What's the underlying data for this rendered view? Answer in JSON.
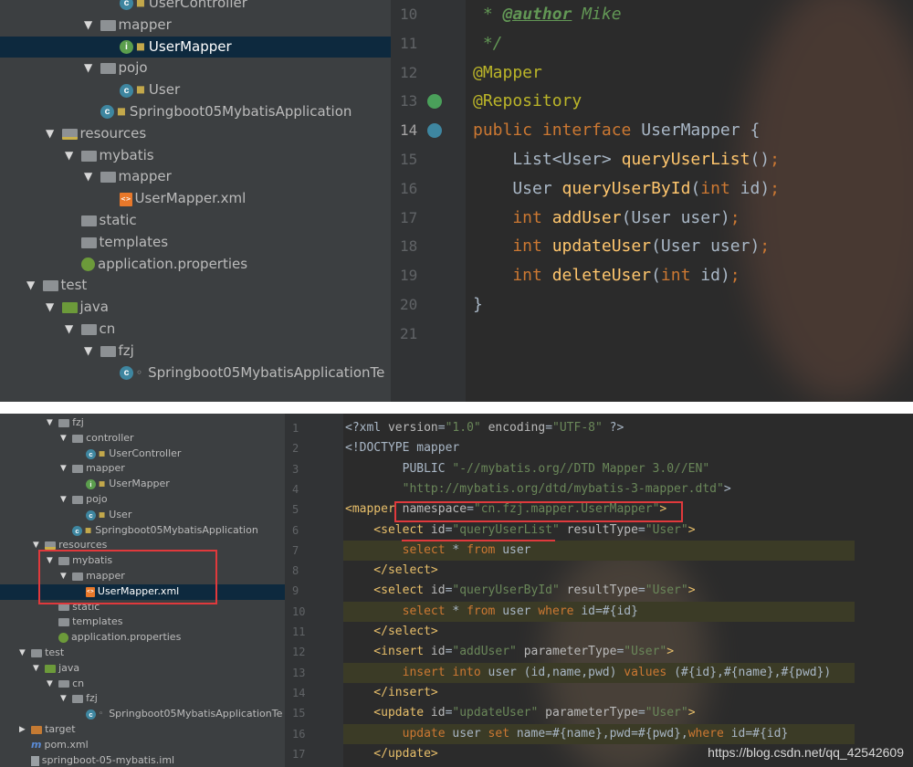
{
  "top_panel": {
    "tree": [
      {
        "indent": 5,
        "arrow": "",
        "icon": "class",
        "label": "UserController"
      },
      {
        "indent": 4,
        "arrow": "▼",
        "icon": "folder",
        "label": "mapper"
      },
      {
        "indent": 5,
        "arrow": "",
        "icon": "interface",
        "label": "UserMapper",
        "selected": true
      },
      {
        "indent": 4,
        "arrow": "▼",
        "icon": "folder",
        "label": "pojo"
      },
      {
        "indent": 5,
        "arrow": "",
        "icon": "class",
        "label": "User"
      },
      {
        "indent": 4,
        "arrow": "",
        "icon": "springclass",
        "label": "Springboot05MybatisApplication"
      },
      {
        "indent": 2,
        "arrow": "▼",
        "icon": "resfolder",
        "label": "resources"
      },
      {
        "indent": 3,
        "arrow": "▼",
        "icon": "folder",
        "label": "mybatis"
      },
      {
        "indent": 4,
        "arrow": "▼",
        "icon": "folder",
        "label": "mapper"
      },
      {
        "indent": 5,
        "arrow": "",
        "icon": "xml",
        "label": "UserMapper.xml"
      },
      {
        "indent": 3,
        "arrow": "",
        "icon": "folder",
        "label": "static"
      },
      {
        "indent": 3,
        "arrow": "",
        "icon": "folder",
        "label": "templates"
      },
      {
        "indent": 3,
        "arrow": "",
        "icon": "properties",
        "label": "application.properties"
      },
      {
        "indent": 1,
        "arrow": "▼",
        "icon": "folder",
        "label": "test"
      },
      {
        "indent": 2,
        "arrow": "▼",
        "icon": "greenfolder",
        "label": "java"
      },
      {
        "indent": 3,
        "arrow": "▼",
        "icon": "folder",
        "label": "cn"
      },
      {
        "indent": 4,
        "arrow": "▼",
        "icon": "folder",
        "label": "fzj"
      },
      {
        "indent": 5,
        "arrow": "",
        "icon": "testclass",
        "label": "Springboot05MybatisApplicationTe"
      }
    ],
    "line_numbers": [
      "10",
      "11",
      "12",
      "13",
      "14",
      "15",
      "16",
      "17",
      "18",
      "19",
      "20",
      "21"
    ],
    "code": [
      [
        {
          "c": "dk",
          "t": " * "
        },
        {
          "c": "dtag",
          "t": "@author"
        },
        {
          "c": "dk",
          "t": " Mike"
        }
      ],
      [
        {
          "c": "dk",
          "t": " */"
        }
      ],
      [
        {
          "c": "ann",
          "t": "@Mapper"
        }
      ],
      [
        {
          "c": "ann",
          "t": "@Repository"
        }
      ],
      [
        {
          "c": "kw",
          "t": "public interface "
        },
        {
          "c": "",
          "t": "UserMapper {"
        }
      ],
      [
        {
          "c": "",
          "t": "    List<User> "
        },
        {
          "c": "fn",
          "t": "queryUserList"
        },
        {
          "c": "",
          "t": "()"
        },
        {
          "c": "kw",
          "t": ";"
        }
      ],
      [
        {
          "c": "",
          "t": "    User "
        },
        {
          "c": "fn",
          "t": "queryUserById"
        },
        {
          "c": "",
          "t": "("
        },
        {
          "c": "kw",
          "t": "int "
        },
        {
          "c": "",
          "t": "id)"
        },
        {
          "c": "kw",
          "t": ";"
        }
      ],
      [
        {
          "c": "kw",
          "t": "    int "
        },
        {
          "c": "fn",
          "t": "addUser"
        },
        {
          "c": "",
          "t": "(User user)"
        },
        {
          "c": "kw",
          "t": ";"
        }
      ],
      [
        {
          "c": "kw",
          "t": "    int "
        },
        {
          "c": "fn",
          "t": "updateUser"
        },
        {
          "c": "",
          "t": "(User user)"
        },
        {
          "c": "kw",
          "t": ";"
        }
      ],
      [
        {
          "c": "kw",
          "t": "    int "
        },
        {
          "c": "fn",
          "t": "deleteUser"
        },
        {
          "c": "",
          "t": "("
        },
        {
          "c": "kw",
          "t": "int "
        },
        {
          "c": "",
          "t": "id)"
        },
        {
          "c": "kw",
          "t": ";"
        }
      ],
      [
        {
          "c": "",
          "t": "}"
        }
      ],
      [
        {
          "c": "",
          "t": ""
        }
      ]
    ]
  },
  "bottom_panel": {
    "tree": [
      {
        "indent": 3,
        "arrow": "▼",
        "icon": "folder",
        "label": "fzj"
      },
      {
        "indent": 4,
        "arrow": "▼",
        "icon": "folder",
        "label": "controller"
      },
      {
        "indent": 5,
        "arrow": "",
        "icon": "class",
        "label": "UserController"
      },
      {
        "indent": 4,
        "arrow": "▼",
        "icon": "folder",
        "label": "mapper"
      },
      {
        "indent": 5,
        "arrow": "",
        "icon": "interface",
        "label": "UserMapper"
      },
      {
        "indent": 4,
        "arrow": "▼",
        "icon": "folder",
        "label": "pojo"
      },
      {
        "indent": 5,
        "arrow": "",
        "icon": "class",
        "label": "User"
      },
      {
        "indent": 4,
        "arrow": "",
        "icon": "springclass",
        "label": "Springboot05MybatisApplication"
      },
      {
        "indent": 2,
        "arrow": "▼",
        "icon": "resfolder",
        "label": "resources"
      },
      {
        "indent": 3,
        "arrow": "▼",
        "icon": "folder",
        "label": "mybatis"
      },
      {
        "indent": 4,
        "arrow": "▼",
        "icon": "folder",
        "label": "mapper"
      },
      {
        "indent": 5,
        "arrow": "",
        "icon": "xml",
        "label": "UserMapper.xml",
        "selected": true
      },
      {
        "indent": 3,
        "arrow": "",
        "icon": "folder",
        "label": "static"
      },
      {
        "indent": 3,
        "arrow": "",
        "icon": "folder",
        "label": "templates"
      },
      {
        "indent": 3,
        "arrow": "",
        "icon": "properties",
        "label": "application.properties"
      },
      {
        "indent": 1,
        "arrow": "▼",
        "icon": "folder",
        "label": "test"
      },
      {
        "indent": 2,
        "arrow": "▼",
        "icon": "greenfolder",
        "label": "java"
      },
      {
        "indent": 3,
        "arrow": "▼",
        "icon": "folder",
        "label": "cn"
      },
      {
        "indent": 4,
        "arrow": "▼",
        "icon": "folder",
        "label": "fzj"
      },
      {
        "indent": 5,
        "arrow": "",
        "icon": "testclass",
        "label": "Springboot05MybatisApplicationTe"
      },
      {
        "indent": 1,
        "arrow": "▶",
        "icon": "targetfolder",
        "label": "target"
      },
      {
        "indent": 1,
        "arrow": "",
        "icon": "pom",
        "label": "pom.xml"
      },
      {
        "indent": 1,
        "arrow": "",
        "icon": "iml",
        "label": "springboot-05-mybatis.iml"
      }
    ],
    "line_numbers": [
      "1",
      "2",
      "3",
      "4",
      "5",
      "6",
      "7",
      "8",
      "9",
      "10",
      "11",
      "12",
      "13",
      "14",
      "15",
      "16",
      "17"
    ],
    "code": [
      [
        {
          "c": "",
          "t": "<?xml "
        },
        {
          "c": "attr",
          "t": "version"
        },
        {
          "c": "",
          "t": "="
        },
        {
          "c": "str",
          "t": "\"1.0\""
        },
        {
          "c": "",
          "t": " "
        },
        {
          "c": "attr",
          "t": "encoding"
        },
        {
          "c": "",
          "t": "="
        },
        {
          "c": "str",
          "t": "\"UTF-8\""
        },
        {
          "c": "",
          "t": " ?>"
        }
      ],
      [
        {
          "c": "",
          "t": "<!DOCTYPE mapper"
        }
      ],
      [
        {
          "c": "",
          "t": "        PUBLIC "
        },
        {
          "c": "str",
          "t": "\"-//mybatis.org//DTD Mapper 3.0//EN\""
        }
      ],
      [
        {
          "c": "str",
          "t": "        \"http://mybatis.org/dtd/mybatis-3-mapper.dtd\""
        },
        {
          "c": "",
          "t": ">"
        }
      ],
      [
        {
          "c": "tag",
          "t": "<mapper "
        },
        {
          "c": "attr",
          "t": "namespace"
        },
        {
          "c": "",
          "t": "="
        },
        {
          "c": "str",
          "t": "\"cn.fzj.mapper.UserMapper\""
        },
        {
          "c": "tag",
          "t": ">"
        }
      ],
      [
        {
          "c": "tag",
          "t": "    <select "
        },
        {
          "c": "attr",
          "t": "id"
        },
        {
          "c": "",
          "t": "="
        },
        {
          "c": "str",
          "t": "\"queryUserList\""
        },
        {
          "c": "",
          "t": " "
        },
        {
          "c": "attr",
          "t": "resultType"
        },
        {
          "c": "",
          "t": "="
        },
        {
          "c": "str",
          "t": "\"User\""
        },
        {
          "c": "tag",
          "t": ">"
        }
      ],
      [
        {
          "c": "sqlkw",
          "t": "        select "
        },
        {
          "c": "",
          "t": "* "
        },
        {
          "c": "sqlkw",
          "t": "from "
        },
        {
          "c": "",
          "t": "user"
        }
      ],
      [
        {
          "c": "tag",
          "t": "    </select>"
        }
      ],
      [
        {
          "c": "tag",
          "t": "    <select "
        },
        {
          "c": "attr",
          "t": "id"
        },
        {
          "c": "",
          "t": "="
        },
        {
          "c": "str",
          "t": "\"queryUserById\""
        },
        {
          "c": "",
          "t": " "
        },
        {
          "c": "attr",
          "t": "resultType"
        },
        {
          "c": "",
          "t": "="
        },
        {
          "c": "str",
          "t": "\"User\""
        },
        {
          "c": "tag",
          "t": ">"
        }
      ],
      [
        {
          "c": "sqlkw",
          "t": "        select "
        },
        {
          "c": "",
          "t": "* "
        },
        {
          "c": "sqlkw",
          "t": "from "
        },
        {
          "c": "",
          "t": "user "
        },
        {
          "c": "sqlkw",
          "t": "where "
        },
        {
          "c": "",
          "t": "id=#{id}"
        }
      ],
      [
        {
          "c": "tag",
          "t": "    </select>"
        }
      ],
      [
        {
          "c": "tag",
          "t": "    <insert "
        },
        {
          "c": "attr",
          "t": "id"
        },
        {
          "c": "",
          "t": "="
        },
        {
          "c": "str",
          "t": "\"addUser\""
        },
        {
          "c": "",
          "t": " "
        },
        {
          "c": "attr",
          "t": "parameterType"
        },
        {
          "c": "",
          "t": "="
        },
        {
          "c": "str",
          "t": "\"User\""
        },
        {
          "c": "tag",
          "t": ">"
        }
      ],
      [
        {
          "c": "sqlkw",
          "t": "        insert into "
        },
        {
          "c": "",
          "t": "user (id,name,pwd) "
        },
        {
          "c": "sqlkw",
          "t": "values "
        },
        {
          "c": "",
          "t": "(#{id},#{name},#{pwd})"
        }
      ],
      [
        {
          "c": "tag",
          "t": "    </insert>"
        }
      ],
      [
        {
          "c": "tag",
          "t": "    <update "
        },
        {
          "c": "attr",
          "t": "id"
        },
        {
          "c": "",
          "t": "="
        },
        {
          "c": "str",
          "t": "\"updateUser\""
        },
        {
          "c": "",
          "t": " "
        },
        {
          "c": "attr",
          "t": "parameterType"
        },
        {
          "c": "",
          "t": "="
        },
        {
          "c": "str",
          "t": "\"User\""
        },
        {
          "c": "tag",
          "t": ">"
        }
      ],
      [
        {
          "c": "sqlkw",
          "t": "        update "
        },
        {
          "c": "",
          "t": "user "
        },
        {
          "c": "sqlkw",
          "t": "set "
        },
        {
          "c": "",
          "t": "name=#{name},pwd=#{pwd},"
        },
        {
          "c": "sqlkw",
          "t": "where "
        },
        {
          "c": "",
          "t": "id=#{id}"
        }
      ],
      [
        {
          "c": "tag",
          "t": "    </update>"
        }
      ]
    ]
  },
  "watermark": "https://blog.csdn.net/qq_42542609",
  "colors": {
    "tree_bg": "#3c3f41",
    "editor_bg": "#2b2b2b",
    "gutter_bg": "#313335",
    "keyword": "#cc7832",
    "annotation": "#bbb529",
    "method": "#ffc66d",
    "string": "#6a8759",
    "highlight_box": "#e0393c"
  }
}
